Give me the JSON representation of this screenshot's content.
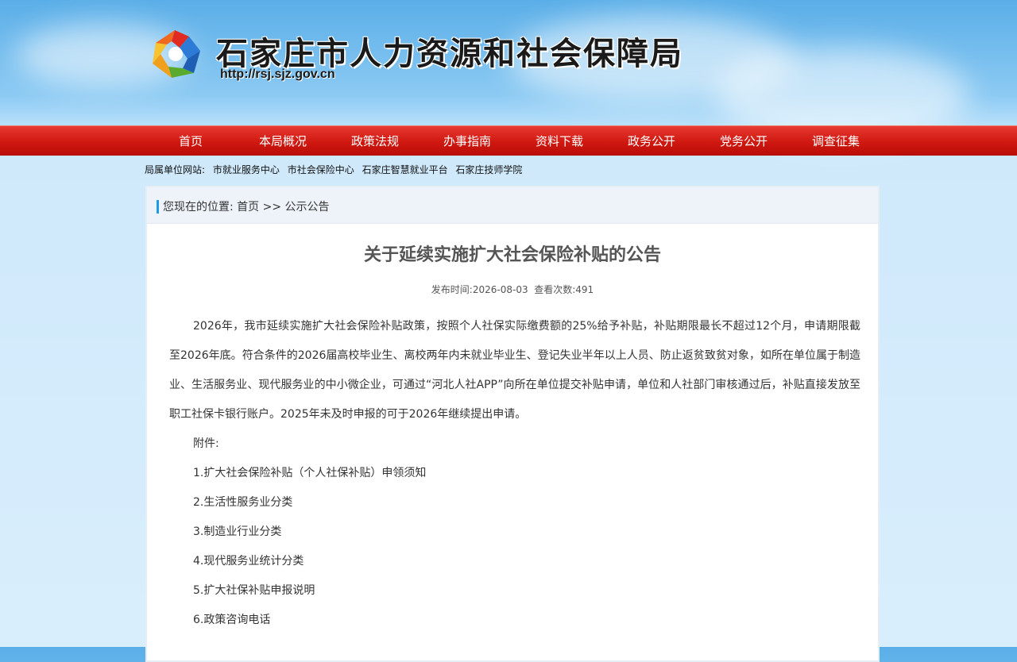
{
  "header": {
    "site_title": "石家庄市人力资源和社会保障局",
    "site_url": "http://rsj.sjz.gov.cn",
    "logo_icon": "rsj-logo-icon"
  },
  "nav": {
    "items": [
      "首页",
      "本局概况",
      "政策法规",
      "办事指南",
      "资料下载",
      "政务公开",
      "党务公开",
      "调查征集"
    ]
  },
  "affiliates": {
    "label": "局属单位网站:",
    "links": [
      "市就业服务中心",
      "市社会保险中心",
      "石家庄智慧就业平台",
      "石家庄技师学院"
    ]
  },
  "breadcrumb": {
    "prefix": "您现在的位置:",
    "home": "首页",
    "separator": ">>",
    "current": "公示公告"
  },
  "article": {
    "title": "关于延续实施扩大社会保险补贴的公告",
    "publish_label": "发布时间:",
    "publish_date": "2026-08-03",
    "views_label": "查看次数:",
    "views": "491",
    "body": "2026年，我市延续实施扩大社会保险补贴政策，按照个人社保实际缴费额的25%给予补贴，补贴期限最长不超过12个月，申请期限截至2026年底。符合条件的2026届高校毕业生、离校两年内未就业毕业生、登记失业半年以上人员、防止返贫致贫对象，如所在单位属于制造业、生活服务业、现代服务业的中小微企业，可通过“河北人社APP”向所在单位提交补贴申请，单位和人社部门审核通过后，补贴直接发放至职工社保卡银行账户。2025年未及时申报的可于2026年继续提出申请。",
    "attachments_label": "附件:",
    "attachments": [
      "1.扩大社会保险补贴（个人社保补贴）申领须知",
      "2.生活性服务业分类",
      "3.制造业行业分类",
      "4.现代服务业统计分类",
      "5.扩大社保补贴申报说明",
      "6.政策咨询电话"
    ]
  },
  "colors": {
    "nav_red": "#cf1810",
    "accent_blue": "#1e9be6",
    "sky": "#8ccaf3"
  }
}
